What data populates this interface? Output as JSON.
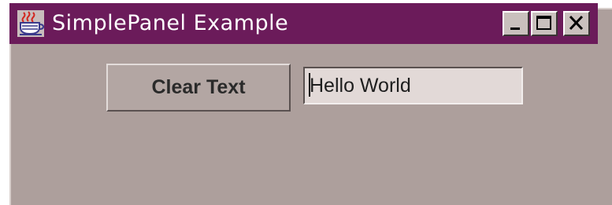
{
  "window": {
    "title": "SimplePanel Example",
    "controls": {
      "minimize_icon": "minimize-icon",
      "maximize_icon": "maximize-icon",
      "close_icon": "close-icon"
    },
    "app_icon": "java-cup-icon"
  },
  "panel": {
    "clear_button_label": "Clear Text",
    "text_field_value": "Hello World"
  },
  "colors": {
    "titlebar": "#6b1b5a",
    "panel_background": "#ad9f9c",
    "text_field_background": "#e2d9d7"
  }
}
